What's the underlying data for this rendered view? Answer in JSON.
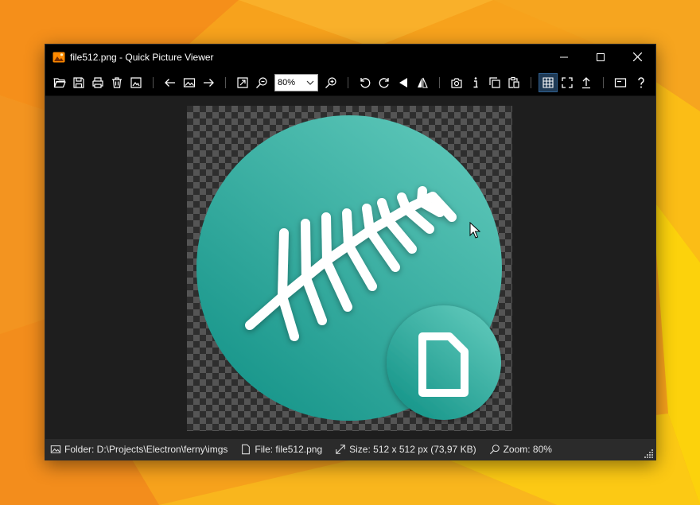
{
  "window": {
    "title": "file512.png - Quick Picture Viewer"
  },
  "toolbar": {
    "zoom_value": "80%",
    "icons": [
      "open-folder-icon",
      "save-icon",
      "print-icon",
      "delete-icon",
      "set-wallpaper-icon",
      "previous-icon",
      "image-icon",
      "next-icon",
      "autosize-icon",
      "zoom-out-icon",
      "zoom-in-icon",
      "rotate-left-icon",
      "rotate-right-icon",
      "flip-horizontal-icon",
      "flip-vertical-icon",
      "screenshot-icon",
      "info-icon",
      "copy-icon",
      "paste-icon",
      "checkerboard-icon",
      "fullscreen-icon",
      "open-with-icon",
      "slideshow-icon",
      "help-icon"
    ]
  },
  "statusbar": {
    "folder": "Folder: D:\\Projects\\Electron\\ferny\\imgs",
    "file": "File: file512.png",
    "size": "Size: 512 x 512 px (73,97 KB)",
    "zoom": "Zoom: 80%"
  },
  "colors": {
    "teal_light": "#5cc6b8",
    "teal_dark": "#17958a",
    "accent": "#1f3a55"
  }
}
